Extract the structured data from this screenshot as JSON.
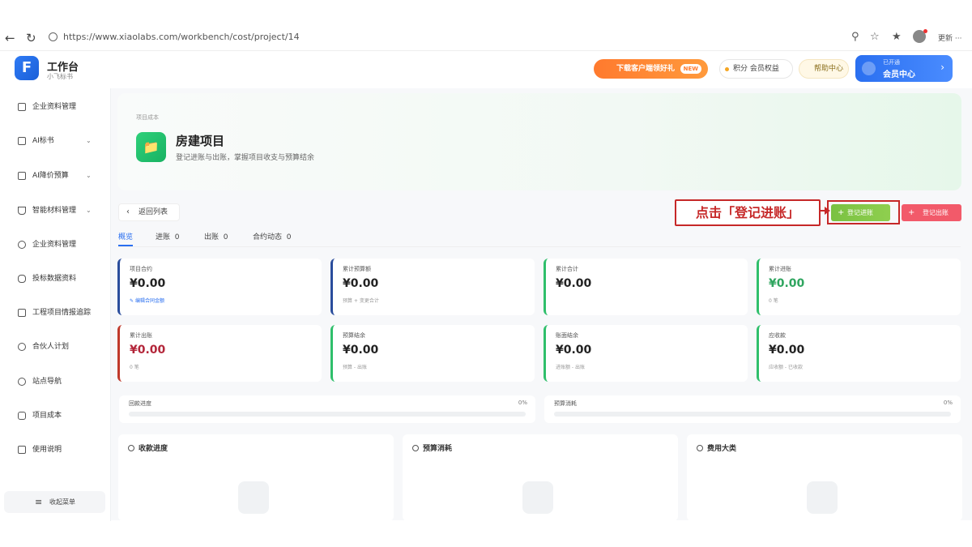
{
  "browser": {
    "url": "https://www.xiaolabs.com/workbench/cost/project/14",
    "profile_label": "更新 ···"
  },
  "header": {
    "app_title": "工作台",
    "app_subtitle": "小飞标书",
    "promo_label": "下载客户端领好礼",
    "promo_badge": "NEW",
    "points_label": "积分 会员权益",
    "help_label": "帮助中心",
    "member_small": "已开通",
    "member_label": "会员中心",
    "logo_letter": "F"
  },
  "sidebar": {
    "items": [
      {
        "label": "企业资料管理",
        "icon": "building-icon",
        "chevron": false
      },
      {
        "label": "AI标书",
        "icon": "document-icon",
        "chevron": true
      },
      {
        "label": "AI降价预算",
        "icon": "calculator-icon",
        "chevron": true
      },
      {
        "label": "智能材料管理",
        "icon": "filter-icon",
        "chevron": true
      },
      {
        "label": "企业资料管理",
        "icon": "search-icon",
        "chevron": false
      },
      {
        "label": "投标数据资料",
        "icon": "chat-icon",
        "chevron": false
      },
      {
        "label": "工程项目情报追踪",
        "icon": "monitor-icon",
        "chevron": false
      },
      {
        "label": "合伙人计划",
        "icon": "partner-icon",
        "chevron": false
      },
      {
        "label": "站点导航",
        "icon": "compass-icon",
        "chevron": false
      },
      {
        "label": "项目成本",
        "icon": "database-icon",
        "chevron": false
      },
      {
        "label": "使用说明",
        "icon": "help-doc-icon",
        "chevron": false
      }
    ],
    "collapse_label": "收起菜单"
  },
  "hero": {
    "breadcrumb": "项目成本",
    "title": "房建项目",
    "subtitle": "登记进账与出账，掌握项目收支与预算结余"
  },
  "back_label": "返回列表",
  "tabs": [
    {
      "label": "概览",
      "count": ""
    },
    {
      "label": "进账",
      "count": "0"
    },
    {
      "label": "出账",
      "count": "0"
    },
    {
      "label": "合约动态",
      "count": "0"
    }
  ],
  "actions": {
    "income_label": "登记进账",
    "expense_label": "登记出账"
  },
  "callout": {
    "text": "点击「登记进账」"
  },
  "stats": [
    {
      "label": "项目合约",
      "value": "¥0.00",
      "note": "编辑合同金额",
      "note_is_link": true,
      "border": "#2a4d9c",
      "value_color": "#222222"
    },
    {
      "label": "累计预算额",
      "value": "¥0.00",
      "note": "预算 + 变更合计",
      "note_is_link": false,
      "border": "#2a4d9c",
      "value_color": "#222222"
    },
    {
      "label": "累计合计",
      "value": "¥0.00",
      "note": "",
      "note_is_link": false,
      "border": "#2fbf6b",
      "value_color": "#222222"
    },
    {
      "label": "累计进账",
      "value": "¥0.00",
      "note": "0 笔",
      "note_is_link": false,
      "border": "#2fbf6b",
      "value_color": "#2fa55f"
    },
    {
      "label": "累计出账",
      "value": "¥0.00",
      "note": "0 笔",
      "note_is_link": false,
      "border": "#c0392b",
      "value_color": "#b3263a"
    },
    {
      "label": "预算结余",
      "value": "¥0.00",
      "note": "预算 - 出账",
      "note_is_link": false,
      "border": "#2fbf6b",
      "value_color": "#222222"
    },
    {
      "label": "账面结余",
      "value": "¥0.00",
      "note": "进账额 - 出账",
      "note_is_link": false,
      "border": "#2fbf6b",
      "value_color": "#222222"
    },
    {
      "label": "应收款",
      "value": "¥0.00",
      "note": "应收额 - 已收款",
      "note_is_link": false,
      "border": "#2fbf6b",
      "value_color": "#222222"
    }
  ],
  "progress": [
    {
      "label": "回款进度",
      "pct_label": "0%",
      "value": 0
    },
    {
      "label": "预算消耗",
      "pct_label": "0%",
      "value": 0
    }
  ],
  "panels": [
    {
      "title": "收款进度"
    },
    {
      "title": "预算消耗"
    },
    {
      "title": "费用大类"
    }
  ]
}
